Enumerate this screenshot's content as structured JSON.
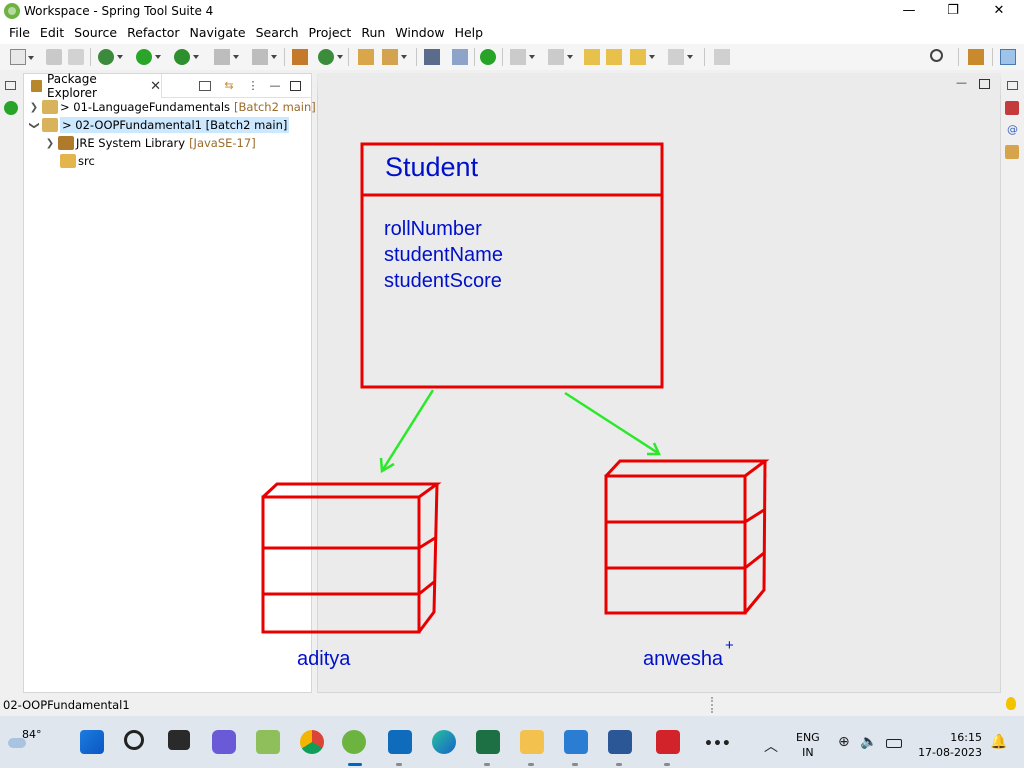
{
  "window": {
    "title": "Workspace - Spring Tool Suite 4",
    "controls": {
      "minimize": "—",
      "maximize": "❐",
      "close": "✕"
    }
  },
  "menu": [
    "File",
    "Edit",
    "Source",
    "Refactor",
    "Navigate",
    "Search",
    "Project",
    "Run",
    "Window",
    "Help"
  ],
  "package_explorer": {
    "tab_label": "Package Explorer",
    "close": "✕",
    "tree": [
      {
        "label": "> 01-LanguageFundamentals",
        "decoration": "[Batch2 main]"
      },
      {
        "label": "> 02-OOPFundamental1",
        "decoration": "[Batch2 main]",
        "selected": true
      },
      {
        "label": "JRE System Library",
        "decoration": "[JavaSE-17]"
      },
      {
        "label": "src",
        "decoration": ""
      }
    ]
  },
  "diagram": {
    "class_name": "Student",
    "fields": [
      "rollNumber",
      "studentName",
      "studentScore"
    ],
    "objects": [
      "aditya",
      "anwesha"
    ],
    "plus_mark": "+",
    "colors": {
      "box": "#e80000",
      "text": "#0010c8",
      "arrow": "#29e929"
    }
  },
  "status_bar": {
    "text": "02-OOPFundamental1"
  },
  "taskbar": {
    "weather": "84°",
    "language": [
      "ENG",
      "IN"
    ],
    "time": "16:15",
    "date": "17-08-2023",
    "overflow": "•••"
  }
}
